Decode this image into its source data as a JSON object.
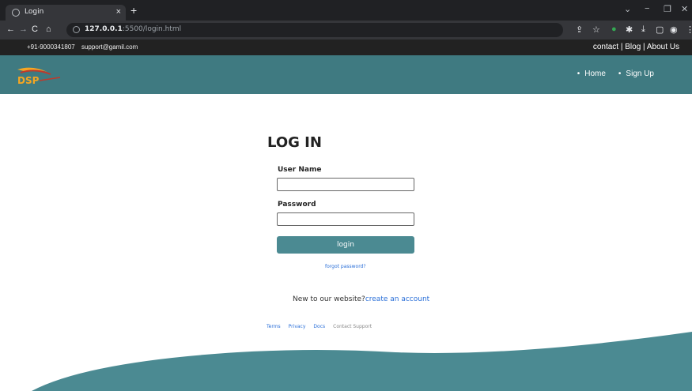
{
  "browser": {
    "tab_title": "Login",
    "tab_close": "×",
    "new_tab": "+",
    "url_host": "127.0.0.1",
    "url_path": ":5500/login.html",
    "nav_icons": [
      "back-icon",
      "forward-icon",
      "reload-icon",
      "home-icon"
    ],
    "window_controls": [
      "⌄",
      "−",
      "❐",
      "✕"
    ]
  },
  "infobar": {
    "phone": "+91-9000341807",
    "email": "support@gamil.com",
    "links": "contact | Blog | About Us"
  },
  "header": {
    "logo_text": "DSP",
    "nav": [
      "Home",
      "Sign Up"
    ]
  },
  "login": {
    "title": "LOG IN",
    "username_label": "User Name",
    "username_value": "",
    "password_label": "Password",
    "password_value": "",
    "button_label": "login",
    "forgot": "forgot password?",
    "new_prompt": "New to our website?",
    "create_link": "create an account"
  },
  "footer": {
    "links": [
      "Terms",
      "Privacy",
      "Docs",
      "Contact Support"
    ]
  },
  "colors": {
    "brand": "#3f7a81",
    "button": "#4b8a92",
    "link": "#2a6fd8"
  }
}
